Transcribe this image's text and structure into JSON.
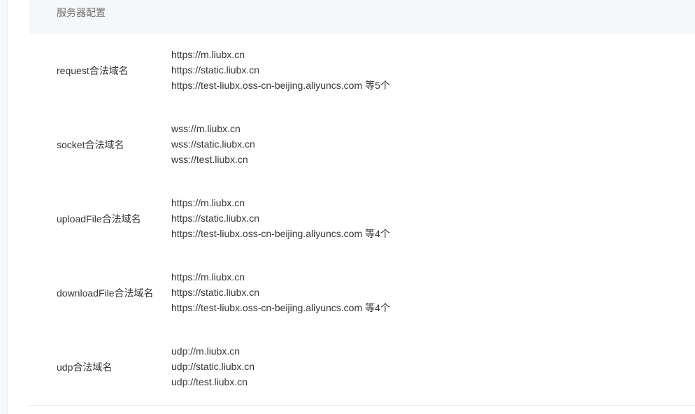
{
  "section": {
    "title": "服务器配置"
  },
  "rows": [
    {
      "label": "request合法域名",
      "values": [
        "https://m.liubx.cn",
        "https://static.liubx.cn",
        "https://test-liubx.oss-cn-beijing.aliyuncs.com"
      ],
      "more": "等5个"
    },
    {
      "label": "socket合法域名",
      "values": [
        "wss://m.liubx.cn",
        "wss://static.liubx.cn",
        "wss://test.liubx.cn"
      ],
      "more": ""
    },
    {
      "label": "uploadFile合法域名",
      "values": [
        "https://m.liubx.cn",
        "https://static.liubx.cn",
        "https://test-liubx.oss-cn-beijing.aliyuncs.com"
      ],
      "more": "等4个"
    },
    {
      "label": "downloadFile合法域名",
      "values": [
        "https://m.liubx.cn",
        "https://static.liubx.cn",
        "https://test-liubx.oss-cn-beijing.aliyuncs.com"
      ],
      "more": "等4个"
    },
    {
      "label": "udp合法域名",
      "values": [
        "udp://m.liubx.cn",
        "udp://static.liubx.cn",
        "udp://test.liubx.cn"
      ],
      "more": ""
    }
  ]
}
